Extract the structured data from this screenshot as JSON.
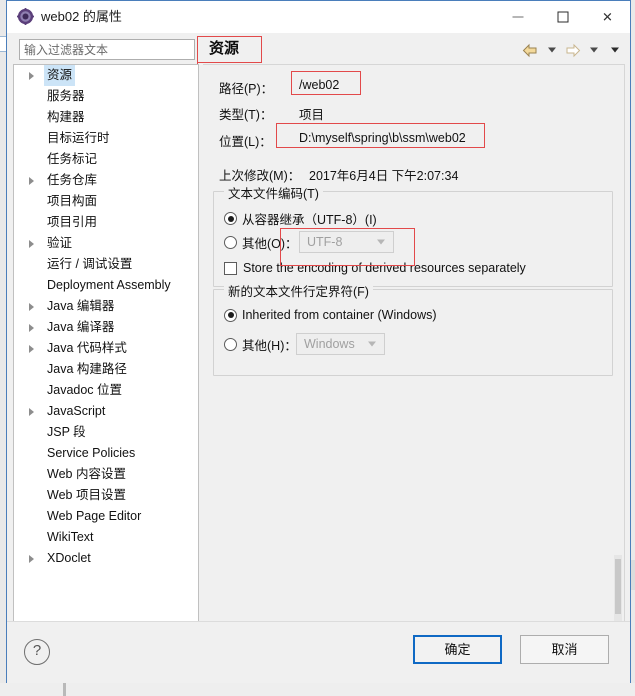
{
  "window": {
    "title": "web02 的属性",
    "icon": "properties-gear-icon",
    "minimize_label": "–",
    "maximize_label": "□",
    "close_label": "✕"
  },
  "toolbar": {
    "filter_placeholder": "输入过滤器文本",
    "filter_value": "",
    "back_icon": "back-arrow-icon",
    "back_menu_icon": "chevron-down-icon",
    "forward_icon": "forward-arrow-icon",
    "forward_menu_icon": "chevron-down-icon",
    "view_menu_icon": "chevron-down-icon"
  },
  "page": {
    "title": "资源"
  },
  "tree": {
    "items": [
      {
        "label": "资源",
        "expandable": true,
        "selected": true,
        "indent": 0
      },
      {
        "label": "服务器",
        "expandable": false,
        "selected": false,
        "indent": 0
      },
      {
        "label": "构建器",
        "expandable": false,
        "selected": false,
        "indent": 0
      },
      {
        "label": "目标运行时",
        "expandable": false,
        "selected": false,
        "indent": 0
      },
      {
        "label": "任务标记",
        "expandable": false,
        "selected": false,
        "indent": 0
      },
      {
        "label": "任务仓库",
        "expandable": true,
        "selected": false,
        "indent": 0
      },
      {
        "label": "项目构面",
        "expandable": false,
        "selected": false,
        "indent": 0
      },
      {
        "label": "项目引用",
        "expandable": false,
        "selected": false,
        "indent": 0
      },
      {
        "label": "验证",
        "expandable": true,
        "selected": false,
        "indent": 0
      },
      {
        "label": "运行 / 调试设置",
        "expandable": false,
        "selected": false,
        "indent": 0
      },
      {
        "label": "Deployment Assembly",
        "expandable": false,
        "selected": false,
        "indent": 0
      },
      {
        "label": "Java 编辑器",
        "expandable": true,
        "selected": false,
        "indent": 0
      },
      {
        "label": "Java 编译器",
        "expandable": true,
        "selected": false,
        "indent": 0
      },
      {
        "label": "Java 代码样式",
        "expandable": true,
        "selected": false,
        "indent": 0
      },
      {
        "label": "Java 构建路径",
        "expandable": false,
        "selected": false,
        "indent": 0
      },
      {
        "label": "Javadoc 位置",
        "expandable": false,
        "selected": false,
        "indent": 0
      },
      {
        "label": "JavaScript",
        "expandable": true,
        "selected": false,
        "indent": 0
      },
      {
        "label": "JSP 段",
        "expandable": false,
        "selected": false,
        "indent": 0
      },
      {
        "label": "Service Policies",
        "expandable": false,
        "selected": false,
        "indent": 0
      },
      {
        "label": "Web 内容设置",
        "expandable": false,
        "selected": false,
        "indent": 0
      },
      {
        "label": "Web 项目设置",
        "expandable": false,
        "selected": false,
        "indent": 0
      },
      {
        "label": "Web Page Editor",
        "expandable": false,
        "selected": false,
        "indent": 0
      },
      {
        "label": "WikiText",
        "expandable": false,
        "selected": false,
        "indent": 0
      },
      {
        "label": "XDoclet",
        "expandable": true,
        "selected": false,
        "indent": 0
      }
    ]
  },
  "resource": {
    "path_label": "路径(P)：",
    "path_value": "/web02",
    "type_label": "类型(T)：",
    "type_value": "项目",
    "location_label": "位置(L)：",
    "location_value": "D:\\myself\\spring\\b\\ssm\\web02",
    "modified_label": "上次修改(M)：",
    "modified_value": "2017年6月4日 下午2:07:34"
  },
  "encoding_group": {
    "title": "文本文件编码(T)",
    "inherit_label": "从容器继承（UTF-8）(I)",
    "inherit_selected": true,
    "other_label": "其他(O)：",
    "other_selected": false,
    "other_value": "UTF-8",
    "store_derived_label": "Store the encoding of derived resources separately",
    "store_derived_checked": false
  },
  "delimiter_group": {
    "title": "新的文本文件行定界符(F)",
    "inherit_label": "Inherited from container (Windows)",
    "inherit_selected": true,
    "other_label": "其他(H)：",
    "other_selected": false,
    "other_value": "Windows"
  },
  "footer": {
    "help_label": "?",
    "ok_label": "确定",
    "cancel_label": "取消"
  },
  "scrollbars": {
    "left_arrow": "‹",
    "right_arrow": "›"
  },
  "colors": {
    "window_border": "#4a7ebb",
    "selection": "#cce4f7",
    "annotation": "#e2494a",
    "default_button_border": "#0f69c4"
  }
}
